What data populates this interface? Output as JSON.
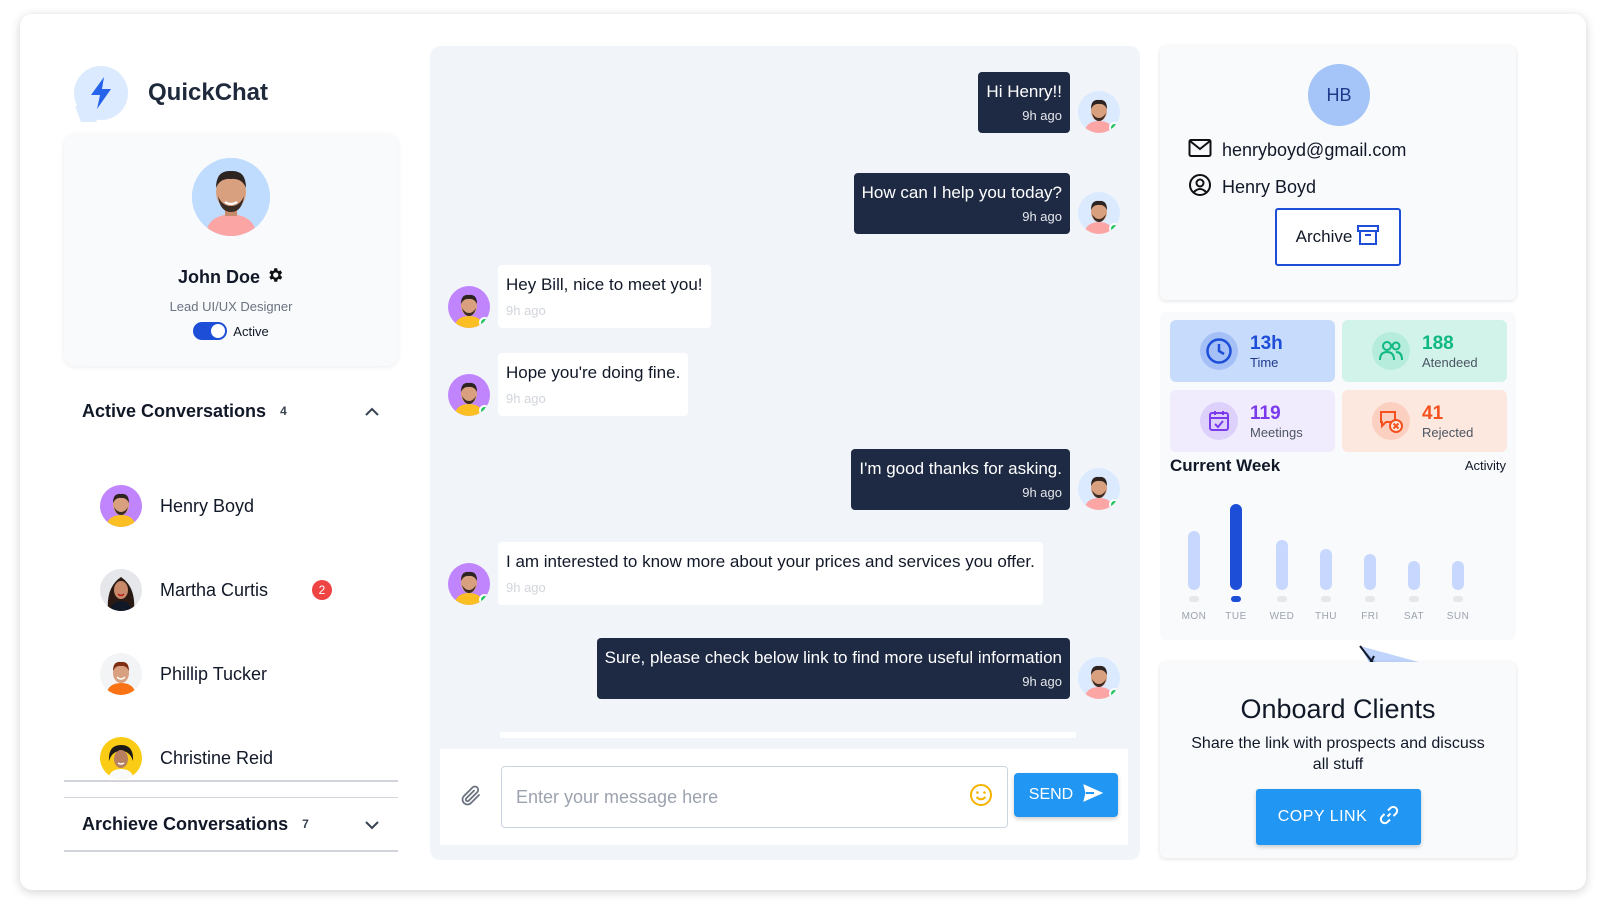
{
  "app": {
    "name": "QuickChat"
  },
  "profile": {
    "name": "John Doe",
    "role": "Lead UI/UX Designer",
    "status": "Active"
  },
  "active_conversations": {
    "title": "Active Conversations",
    "count": "4",
    "items": [
      {
        "name": "Henry Boyd",
        "unread": ""
      },
      {
        "name": "Martha Curtis",
        "unread": "2"
      },
      {
        "name": "Phillip Tucker",
        "unread": ""
      },
      {
        "name": "Christine Reid",
        "unread": ""
      }
    ]
  },
  "archive_conversations": {
    "title": "Archieve Conversations",
    "count": "7"
  },
  "messages": [
    {
      "dir": "out",
      "text": "Hi Henry!!",
      "time": "9h ago"
    },
    {
      "dir": "out",
      "text": "How can I help you today?",
      "time": "9h ago"
    },
    {
      "dir": "in",
      "text": "Hey Bill, nice to meet you!",
      "time": "9h ago"
    },
    {
      "dir": "in",
      "text": "Hope you're doing fine.",
      "time": "9h ago"
    },
    {
      "dir": "out",
      "text": "I'm good thanks for asking.",
      "time": "9h ago"
    },
    {
      "dir": "in",
      "text": "I am interested to know more about your prices and services you offer.",
      "time": "9h ago"
    },
    {
      "dir": "out",
      "text": "Sure, please check below link to find more useful information",
      "time": "9h ago"
    }
  ],
  "composer": {
    "placeholder": "Enter your message here",
    "send_label": "SEND"
  },
  "contact": {
    "initials": "HB",
    "email": "henryboyd@gmail.com",
    "name": "Henry Boyd",
    "archive_label": "Archive"
  },
  "stats": [
    {
      "value": "13h",
      "label": "Time",
      "color": "#1d4ed8"
    },
    {
      "value": "188",
      "label": "Atendeed",
      "color": "#10b981"
    },
    {
      "value": "119",
      "label": "Meetings",
      "color": "#7c3aed"
    },
    {
      "value": "41",
      "label": "Rejected",
      "color": "#f4511e"
    }
  ],
  "week": {
    "title": "Current Week",
    "activity_label": "Activity",
    "days": [
      "MON",
      "TUE",
      "WED",
      "THU",
      "FRI",
      "SAT",
      "SUN"
    ],
    "levels": [
      0.65,
      0.95,
      0.55,
      0.45,
      0.4,
      0.32,
      0.32
    ],
    "highlight": "TUE"
  },
  "onboard": {
    "title": "Onboard Clients",
    "subtitle": "Share the link with prospects and discuss all stuff",
    "copy_label": "COPY LINK"
  },
  "colors": {
    "accent": "#2196f3",
    "dark_bubble": "#1e2a44",
    "online": "#22c55e"
  }
}
